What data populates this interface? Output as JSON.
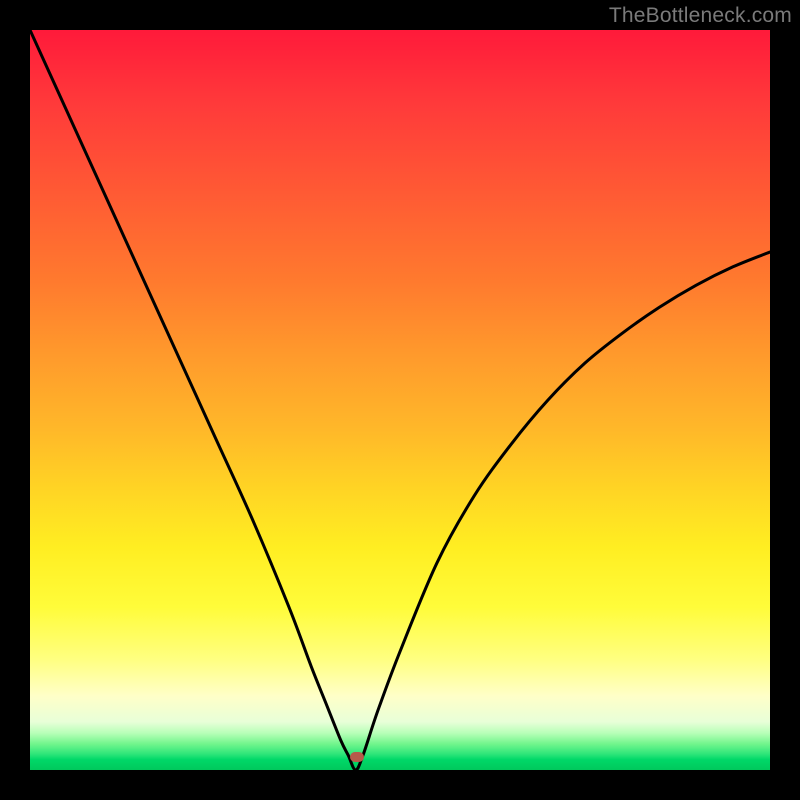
{
  "watermark": "TheBottleneck.com",
  "marker": {
    "x_pct": 44.2,
    "y_pct": 98.3
  },
  "chart_data": {
    "type": "line",
    "title": "",
    "xlabel": "",
    "ylabel": "",
    "xlim": [
      0,
      100
    ],
    "ylim": [
      0,
      100
    ],
    "series": [
      {
        "name": "bottleneck-curve",
        "x": [
          0,
          5,
          10,
          15,
          20,
          25,
          30,
          35,
          38,
          40,
          42,
          43,
          44,
          45,
          47,
          50,
          55,
          60,
          65,
          70,
          75,
          80,
          85,
          90,
          95,
          100
        ],
        "y": [
          100,
          89,
          78,
          67,
          56,
          45,
          34,
          22,
          14,
          9,
          4,
          2,
          0,
          2,
          8,
          16,
          28,
          37,
          44,
          50,
          55,
          59,
          62.5,
          65.5,
          68,
          70
        ]
      }
    ],
    "annotations": [
      {
        "type": "marker",
        "x": 44,
        "y": 1.7,
        "label": "optimal-point"
      }
    ],
    "background_gradient_stops": [
      {
        "pct": 0,
        "color": "#ff1a3a"
      },
      {
        "pct": 50,
        "color": "#ffb028"
      },
      {
        "pct": 78,
        "color": "#fffc3a"
      },
      {
        "pct": 96,
        "color": "#70f58c"
      },
      {
        "pct": 100,
        "color": "#00c85c"
      }
    ]
  }
}
